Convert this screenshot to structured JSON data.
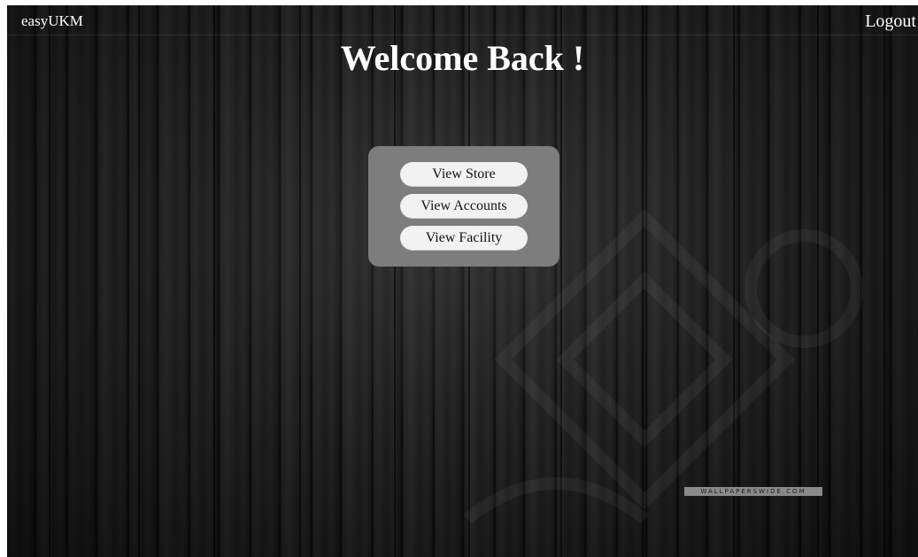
{
  "header": {
    "brand": "easyUKM",
    "logout_label": "Logout"
  },
  "main": {
    "title": "Welcome Back !",
    "menu": {
      "store_label": "View Store",
      "accounts_label": "View Accounts",
      "facility_label": "View Facility"
    }
  },
  "background": {
    "watermark_text": "WALLPAPERSWIDE.COM"
  },
  "colors": {
    "menu_box": "#7d7d7d",
    "button_bg": "#f2f2f2",
    "text": "#ffffff"
  }
}
